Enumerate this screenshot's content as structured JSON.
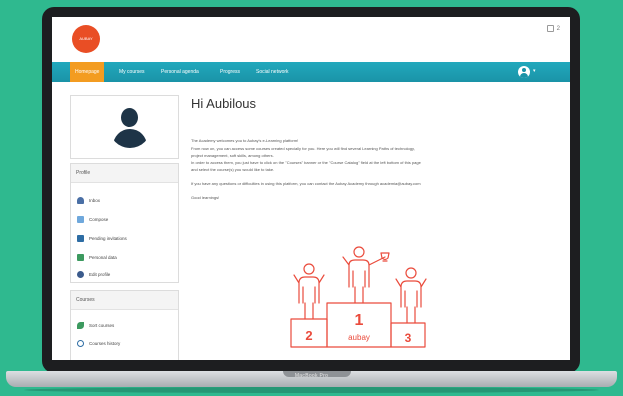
{
  "app": {
    "logo_text": "AUBAY ACADEMY",
    "top_right": "2"
  },
  "nav": {
    "items": [
      {
        "label": "Homepage",
        "active": true
      },
      {
        "label": "My courses"
      },
      {
        "label": "Personal agenda"
      },
      {
        "label": "Progress"
      },
      {
        "label": "Social network"
      }
    ]
  },
  "sidebar": {
    "profile": {
      "title": "Profile",
      "items": [
        {
          "label": "Inbox",
          "icon": "inbox-icon"
        },
        {
          "label": "Compose",
          "icon": "compose-icon"
        },
        {
          "label": "Pending invitations",
          "icon": "invitation-icon"
        },
        {
          "label": "Personal data",
          "icon": "personal-data-icon"
        },
        {
          "label": "Edit profile",
          "icon": "edit-profile-icon"
        }
      ]
    },
    "courses": {
      "title": "Courses",
      "items": [
        {
          "label": "Sort courses",
          "icon": "sort-icon"
        },
        {
          "label": "Courses history",
          "icon": "history-icon"
        }
      ]
    }
  },
  "main": {
    "greeting": "Hi Aubilous",
    "lines": [
      "The Academy welcomes you to Aubay's e-Learning platform!",
      "From now on, you can access some courses created specially for you. Here you will find several Learning Paths of technology,",
      "project management, soft skills, among others.",
      "In order to access them, you just have to click on the \"Courses\" banner or the \"Course Catalog\" field at the left bottom of this page",
      "and select the course(s) you would like to take.",
      "",
      "If you have any questions or difficulties in using this platform, you can contact the Aubay Academy through academia@aubay.com",
      "",
      "Good learnings!"
    ],
    "podium": {
      "places": [
        "2",
        "1",
        "3"
      ],
      "brand": "aubay"
    }
  },
  "device": {
    "label": "MacBook Pro"
  },
  "colors": {
    "background": "#2fb98f",
    "nav": "#1a93a7",
    "nav_active": "#f39c21",
    "accent": "#e94e25"
  }
}
